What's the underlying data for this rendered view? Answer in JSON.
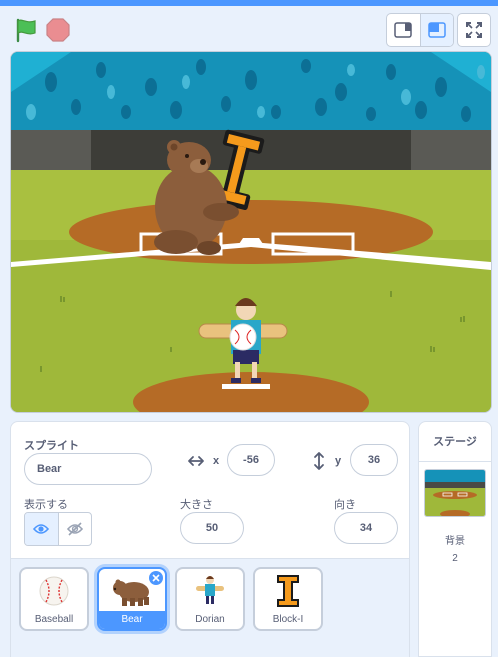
{
  "controls": {
    "green_flag_icon": "green-flag-icon",
    "stop_icon": "stop-icon",
    "small_stage_icon": "small-stage-layout-icon",
    "normal_stage_icon": "normal-stage-layout-icon",
    "fullscreen_icon": "fullscreen-icon"
  },
  "colors": {
    "accent": "#4c97ff",
    "flag": "#4cbf56",
    "stop": "#ec5959"
  },
  "sprite_info": {
    "sprite_label": "スプライト",
    "sprite_name": "Bear",
    "x_label": "x",
    "x_value": "-56",
    "y_label": "y",
    "y_value": "36",
    "show_label": "表示する",
    "size_label": "大きさ",
    "size_value": "50",
    "direction_label": "向き",
    "direction_value": "34"
  },
  "sprites": [
    {
      "name": "Baseball",
      "selected": false
    },
    {
      "name": "Bear",
      "selected": true
    },
    {
      "name": "Dorian",
      "selected": false
    },
    {
      "name": "Block-I",
      "selected": false
    }
  ],
  "stage_panel": {
    "title": "ステージ",
    "backdrops_label": "背景",
    "backdrops_count": "2"
  }
}
